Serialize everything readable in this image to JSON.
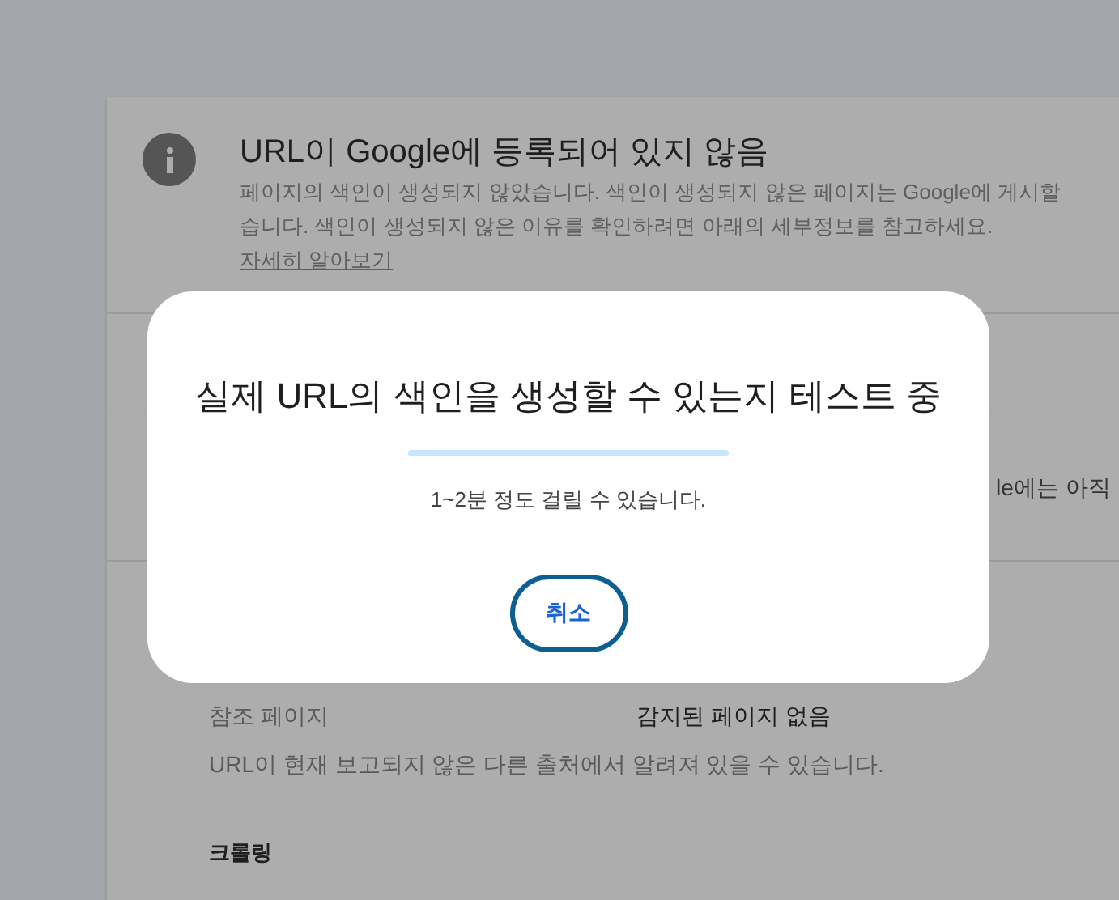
{
  "status_card": {
    "title": "URL이 Google에 등록되어 있지 않음",
    "description_lines": [
      "페이지의 색인이 생성되지 않았습니다. 색인이 생성되지 않은 페이지는 Google에 게시할",
      "습니다. 색인이 생성되지 않은 이유를 확인하려면 아래의 세부정보를 참고하세요."
    ],
    "link": "자세히 알아보기"
  },
  "details_card": {
    "header_fragment": "le에는 아직",
    "rows": [
      {
        "label": "참조 페이지",
        "value": "감지된 페이지 없음"
      }
    ],
    "note": "URL이 현재 보고되지 않은 다른 출처에서 알려져 있을 수 있습니다.",
    "section_title": "크롤링"
  },
  "dialog": {
    "title": "실제 URL의 색인을 생성할 수 있는지 테스트 중",
    "subtitle": "1~2분 정도 걸릴 수 있습니다.",
    "cancel_button": "취소"
  }
}
